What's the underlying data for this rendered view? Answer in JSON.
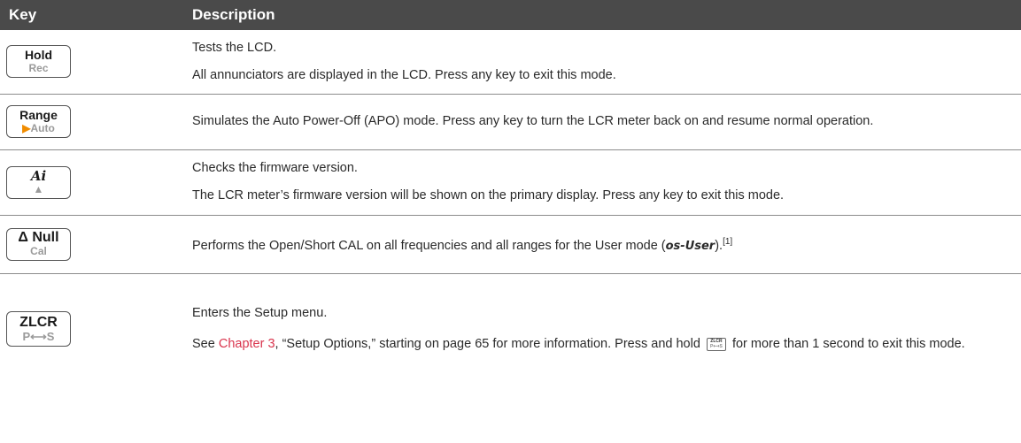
{
  "header": {
    "key": "Key",
    "description": "Description"
  },
  "rows": [
    {
      "key_top": "Hold",
      "key_bottom": "Rec",
      "desc": [
        "Tests the LCD.",
        "All annunciators are displayed in the LCD. Press any key to exit this mode."
      ]
    },
    {
      "key_top": "Range",
      "key_bottom": "Auto",
      "key_bottom_prefix_icon": "orange-triangle-right",
      "desc": [
        "Simulates the Auto Power-Off (APO) mode. Press any key to turn the LCR meter back on and resume normal operation."
      ]
    },
    {
      "key_top": "Ai",
      "key_bottom_icon": "orange-triangle-up",
      "desc": [
        "Checks the firmware version.",
        "The LCR meter’s firmware version will be shown on the primary display. Press any key to exit this mode."
      ]
    },
    {
      "key_top": "Δ Null",
      "key_bottom": "Cal",
      "desc_before": "Performs the Open/Short CAL on all frequencies and all ranges for the User mode (",
      "desc_code": "os-User",
      "desc_after": ").",
      "desc_sup": "[1]"
    },
    {
      "key_top": "ZLCR",
      "key_bottom": "P⟷S",
      "desc_first": "Enters the Setup menu.",
      "desc_see": "See ",
      "desc_link": "Chapter 3",
      "desc_mid": ", “Setup Options,” starting on page 65 for more information. Press and hold ",
      "mini_key_top": "ZLCR",
      "mini_key_bottom": "P⟷S",
      "desc_end": " for more than 1 second to exit this mode."
    }
  ],
  "colors": {
    "header_bg": "#4a4a4a",
    "link": "#d9344d",
    "accent_orange": "#f08c00"
  }
}
